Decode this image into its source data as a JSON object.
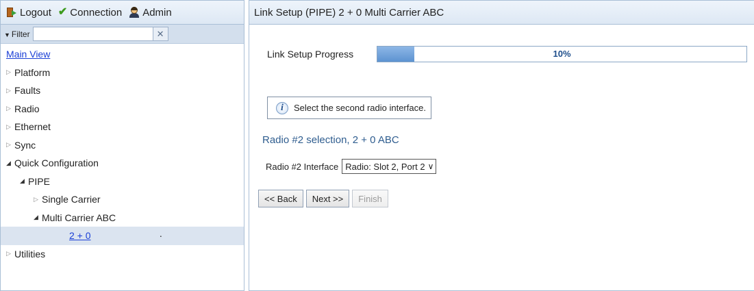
{
  "topbar": {
    "logout_label": "Logout",
    "connection_label": "Connection",
    "admin_label": "Admin"
  },
  "filter": {
    "label": "Filter",
    "value": "",
    "placeholder": "",
    "clear_icon": "close-icon"
  },
  "tree": {
    "main_view": "Main View",
    "platform": "Platform",
    "faults": "Faults",
    "radio": "Radio",
    "ethernet": "Ethernet",
    "sync": "Sync",
    "quick_configuration": "Quick Configuration",
    "pipe": "PIPE",
    "single_carrier": "Single Carrier",
    "multi_carrier_abc": "Multi Carrier ABC",
    "two_plus_zero": "2 + 0",
    "utilities": "Utilities"
  },
  "main": {
    "header_title": "Link Setup (PIPE) 2 + 0 Multi Carrier ABC",
    "progress_label": "Link Setup Progress",
    "progress_value": 0.1,
    "progress_text": "10%",
    "info_text": "Select the second radio interface.",
    "section_title": "Radio #2 selection, 2 + 0 ABC",
    "interface_label": "Radio #2 Interface",
    "interface_selected": "Radio: Slot 2, Port 2",
    "back_button": "<< Back",
    "next_button": "Next >>",
    "finish_button": "Finish"
  },
  "colors": {
    "accent": "#2f5d8f",
    "progress_fill": "#5d93d1",
    "selected_row": "#dbe4f0"
  }
}
